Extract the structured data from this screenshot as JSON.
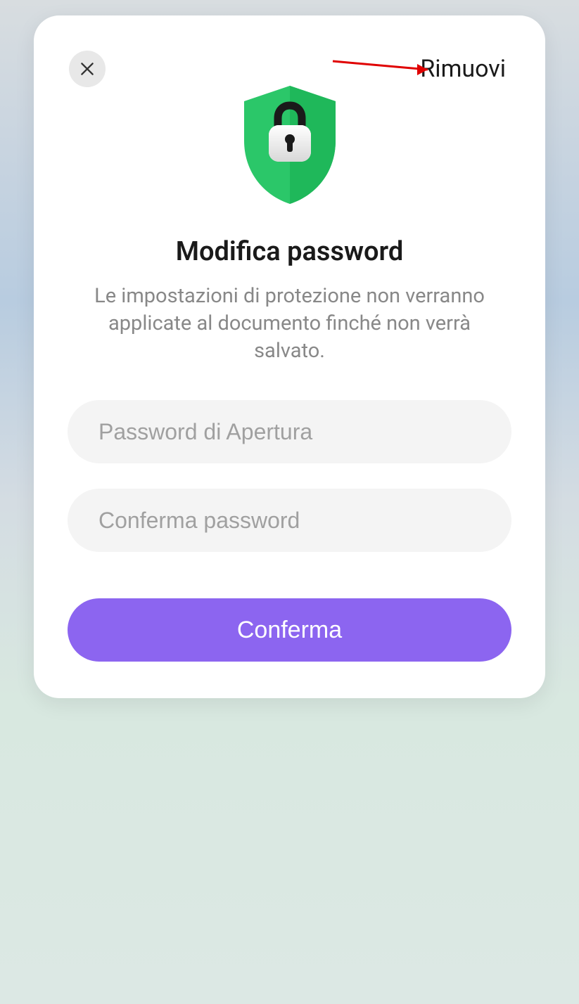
{
  "modal": {
    "removeLabel": "Rimuovi",
    "title": "Modifica password",
    "description": "Le impostazioni di protezione non verranno applicate al documento finché non verrà salvato.",
    "passwordPlaceholder": "Password di Apertura",
    "confirmPasswordPlaceholder": "Conferma password",
    "confirmButton": "Conferma"
  }
}
